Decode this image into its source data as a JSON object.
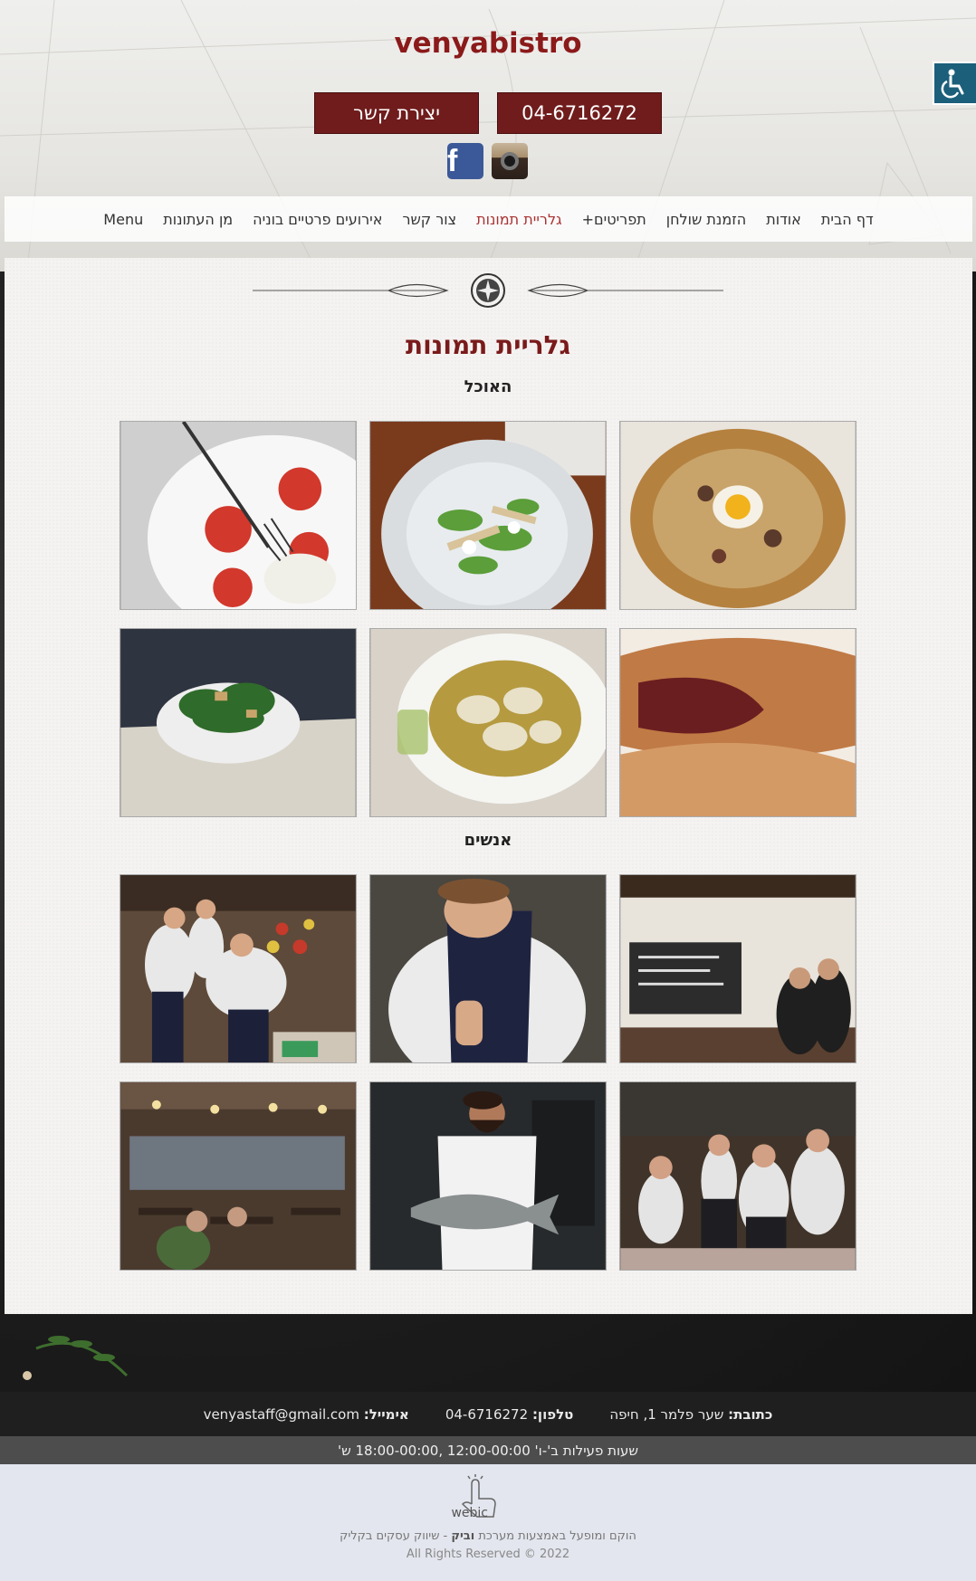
{
  "header": {
    "title": "venyabistro",
    "phone_button": "04-6716272",
    "contact_button": "יצירת קשר",
    "social": [
      "facebook-icon",
      "instagram-icon"
    ]
  },
  "nav": {
    "items": [
      {
        "label": "דף הבית"
      },
      {
        "label": "אודות"
      },
      {
        "label": "הזמנת שולחן"
      },
      {
        "label": "תפריטים+"
      },
      {
        "label": "גלריית תמונות",
        "active": true
      },
      {
        "label": "צור קשר"
      },
      {
        "label": "אירועים פרטיים בוניה"
      },
      {
        "label": "מן העתונות"
      },
      {
        "label": "Menu"
      }
    ]
  },
  "main": {
    "page_title": "גלריית תמונות",
    "sections": [
      {
        "title": "האוכל",
        "photos": [
          "pizza-egg-photo",
          "salad-plate-photo",
          "tomato-mozzarella-photo",
          "pastry-photo",
          "ravioli-photo",
          "green-salad-photo"
        ]
      },
      {
        "title": "אנשים",
        "photos": [
          "bar-staff-photo",
          "chef-plating-photo",
          "kitchen-team-photo",
          "team-toast-photo",
          "chef-fish-photo",
          "dining-room-photo"
        ]
      }
    ]
  },
  "footer": {
    "address_label": "כתובת:",
    "address_value": "שער פלמר 1, חיפה",
    "phone_label": "טלפון:",
    "phone_value": "04-6716272",
    "email_label": "אימייל:",
    "email_value": "venyastaff@gmail.com",
    "hours": "שעות פעילות ב'-ו' 12:00-00:00 ,18:00-00:00 ש'",
    "credit_prefix": "הוקם ומופעל באמצעות מערכת",
    "credit_brand": "וביק",
    "credit_suffix": "- שיווק עסקים בקליק",
    "rights": "All Rights Reserved © 2022",
    "logo_text": "webic"
  },
  "colors": {
    "brand": "#8b1a1a",
    "button": "#701c1c",
    "accessibility": "#1b5f7b"
  }
}
